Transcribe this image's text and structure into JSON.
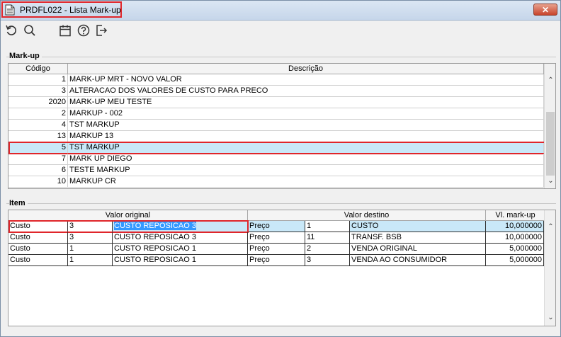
{
  "window": {
    "title": "PRDFL022 - Lista Mark-up",
    "close_label": "✕"
  },
  "toolbar": {
    "items": [
      {
        "icon": "refresh-icon"
      },
      {
        "icon": "search-icon"
      },
      {
        "icon": "calendar-icon"
      },
      {
        "icon": "help-icon"
      },
      {
        "icon": "exit-icon"
      }
    ]
  },
  "markup": {
    "label": "Mark-up",
    "columns": [
      "Código",
      "Descrição"
    ],
    "rows": [
      {
        "codigo": "1",
        "descricao": "MARK-UP MRT - NOVO VALOR"
      },
      {
        "codigo": "3",
        "descricao": "ALTERACAO DOS VALORES DE CUSTO PARA PRECO"
      },
      {
        "codigo": "2020",
        "descricao": "MARK-UP MEU TESTE"
      },
      {
        "codigo": "2",
        "descricao": "MARKUP - 002"
      },
      {
        "codigo": "4",
        "descricao": "TST MARKUP"
      },
      {
        "codigo": "13",
        "descricao": "MARKUP 13"
      },
      {
        "codigo": "5",
        "descricao": "TST MARKUP"
      },
      {
        "codigo": "7",
        "descricao": "MARK UP DIEGO"
      },
      {
        "codigo": "6",
        "descricao": "TESTE MARKUP"
      },
      {
        "codigo": "10",
        "descricao": "MARKUP CR"
      }
    ],
    "selected_index": 6
  },
  "item": {
    "label": "Item",
    "group_headers": [
      "Valor original",
      "Valor destino",
      "Vl. mark-up"
    ],
    "rows": [
      {
        "tipo": "Custo",
        "cod": "3",
        "desc": "CUSTO REPOSICAO 3",
        "dest_tipo": "Preço",
        "dest_cod": "1",
        "dest_desc": "CUSTO",
        "valor": "10,000000"
      },
      {
        "tipo": "Custo",
        "cod": "3",
        "desc": "CUSTO REPOSICAO 3",
        "dest_tipo": "Preço",
        "dest_cod": "11",
        "dest_desc": "TRANSF. BSB",
        "valor": "10,000000"
      },
      {
        "tipo": "Custo",
        "cod": "1",
        "desc": "CUSTO REPOSICAO 1",
        "dest_tipo": "Preço",
        "dest_cod": "2",
        "dest_desc": "VENDA ORIGINAL",
        "valor": "5,000000"
      },
      {
        "tipo": "Custo",
        "cod": "1",
        "desc": "CUSTO REPOSICAO 1",
        "dest_tipo": "Preço",
        "dest_cod": "3",
        "dest_desc": "VENDA AO CONSUMIDOR",
        "valor": "5,000000"
      }
    ],
    "selected_index": 0
  }
}
